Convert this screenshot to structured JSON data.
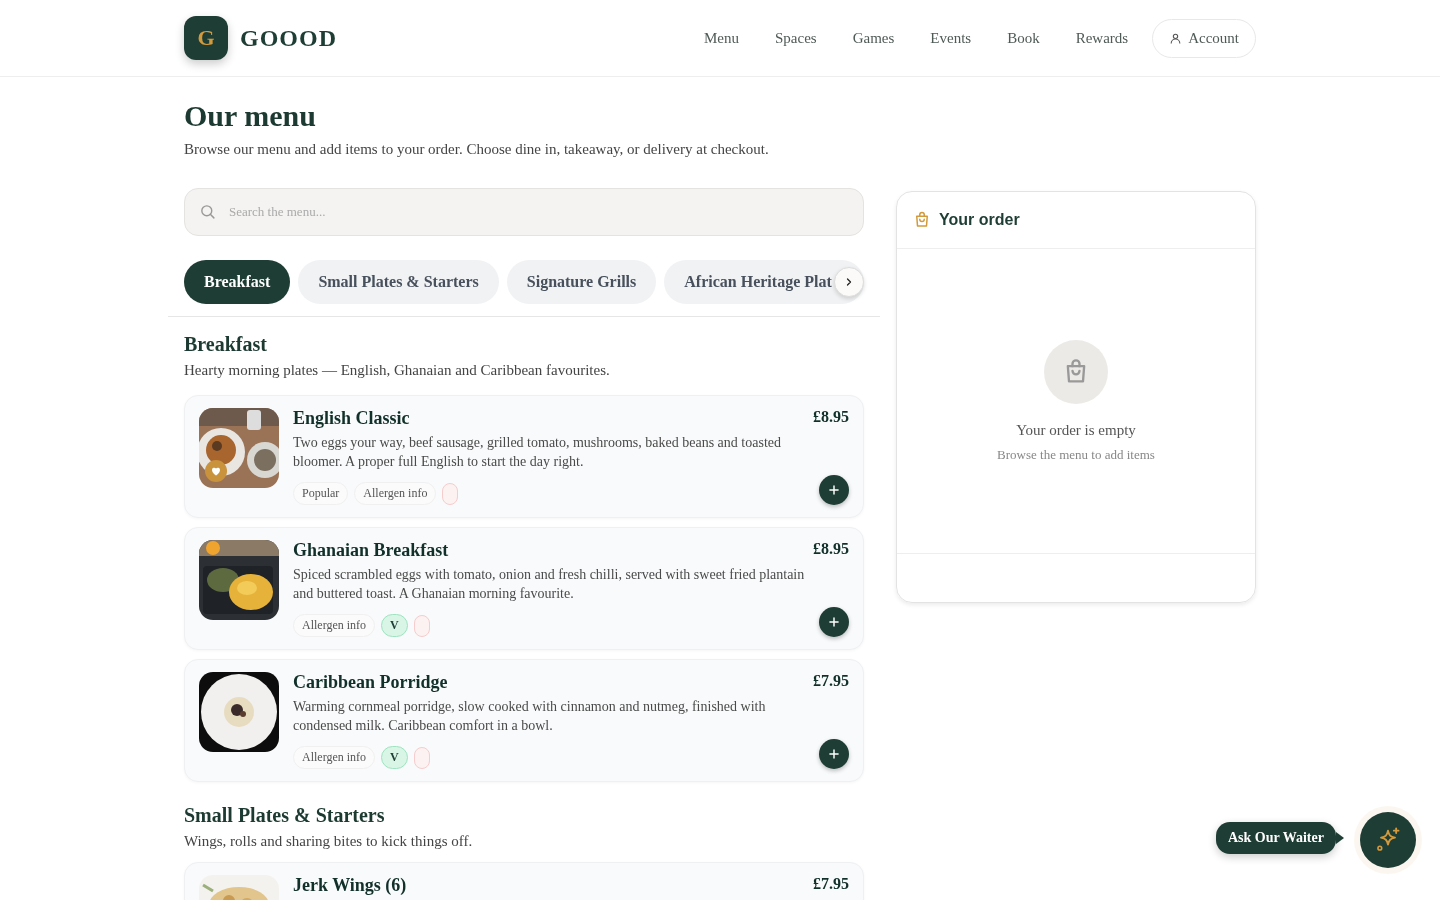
{
  "header": {
    "logo_letter": "G",
    "brand": "GOOOD",
    "nav": [
      {
        "label": "Menu"
      },
      {
        "label": "Spaces"
      },
      {
        "label": "Games"
      },
      {
        "label": "Events"
      },
      {
        "label": "Book"
      },
      {
        "label": "Rewards"
      }
    ],
    "account": "Account"
  },
  "page": {
    "title": "Our menu",
    "subtitle": "Browse our menu and add items to your order. Choose dine in, takeaway, or delivery at checkout."
  },
  "search": {
    "placeholder": "Search the menu..."
  },
  "categories": [
    {
      "label": "Breakfast",
      "selected": true
    },
    {
      "label": "Small Plates & Starters",
      "selected": false
    },
    {
      "label": "Signature Grills",
      "selected": false
    },
    {
      "label": "African Heritage Plat",
      "selected": false
    }
  ],
  "sections": [
    {
      "title": "Breakfast",
      "description": "Hearty morning plates — English, Ghanaian and Caribbean favourites.",
      "items": [
        {
          "name": "English Classic",
          "price": "£8.95",
          "description": "Two eggs your way, beef sausage, grilled tomato, mushrooms, baked beans and toasted bloomer. A proper full English to start the day right.",
          "favorite": true,
          "tags": [
            {
              "kind": "label",
              "text": "Popular"
            },
            {
              "kind": "label",
              "text": "Allergen info"
            },
            {
              "kind": "blank"
            }
          ]
        },
        {
          "name": "Ghanaian Breakfast",
          "price": "£8.95",
          "description": "Spiced scrambled eggs with tomato, onion and fresh chilli, served with sweet fried plantain and buttered toast. A Ghanaian morning favourite.",
          "favorite": false,
          "tags": [
            {
              "kind": "label",
              "text": "Allergen info"
            },
            {
              "kind": "veg",
              "text": "V"
            },
            {
              "kind": "blank"
            }
          ]
        },
        {
          "name": "Caribbean Porridge",
          "price": "£7.95",
          "description": "Warming cornmeal porridge, slow cooked with cinnamon and nutmeg, finished with condensed milk. Caribbean comfort in a bowl.",
          "favorite": false,
          "tags": [
            {
              "kind": "label",
              "text": "Allergen info"
            },
            {
              "kind": "veg",
              "text": "V"
            },
            {
              "kind": "blank"
            }
          ]
        }
      ]
    },
    {
      "title": "Small Plates & Starters",
      "description": "Wings, rolls and sharing bites to kick things off.",
      "items": [
        {
          "name": "Jerk Wings (6)",
          "price": "£7.95",
          "favorite": false
        }
      ]
    }
  ],
  "order": {
    "title": "Your order",
    "empty_title": "Your order is empty",
    "empty_hint": "Browse the menu to add items"
  },
  "assistant": {
    "label": "Ask Our Waiter"
  }
}
